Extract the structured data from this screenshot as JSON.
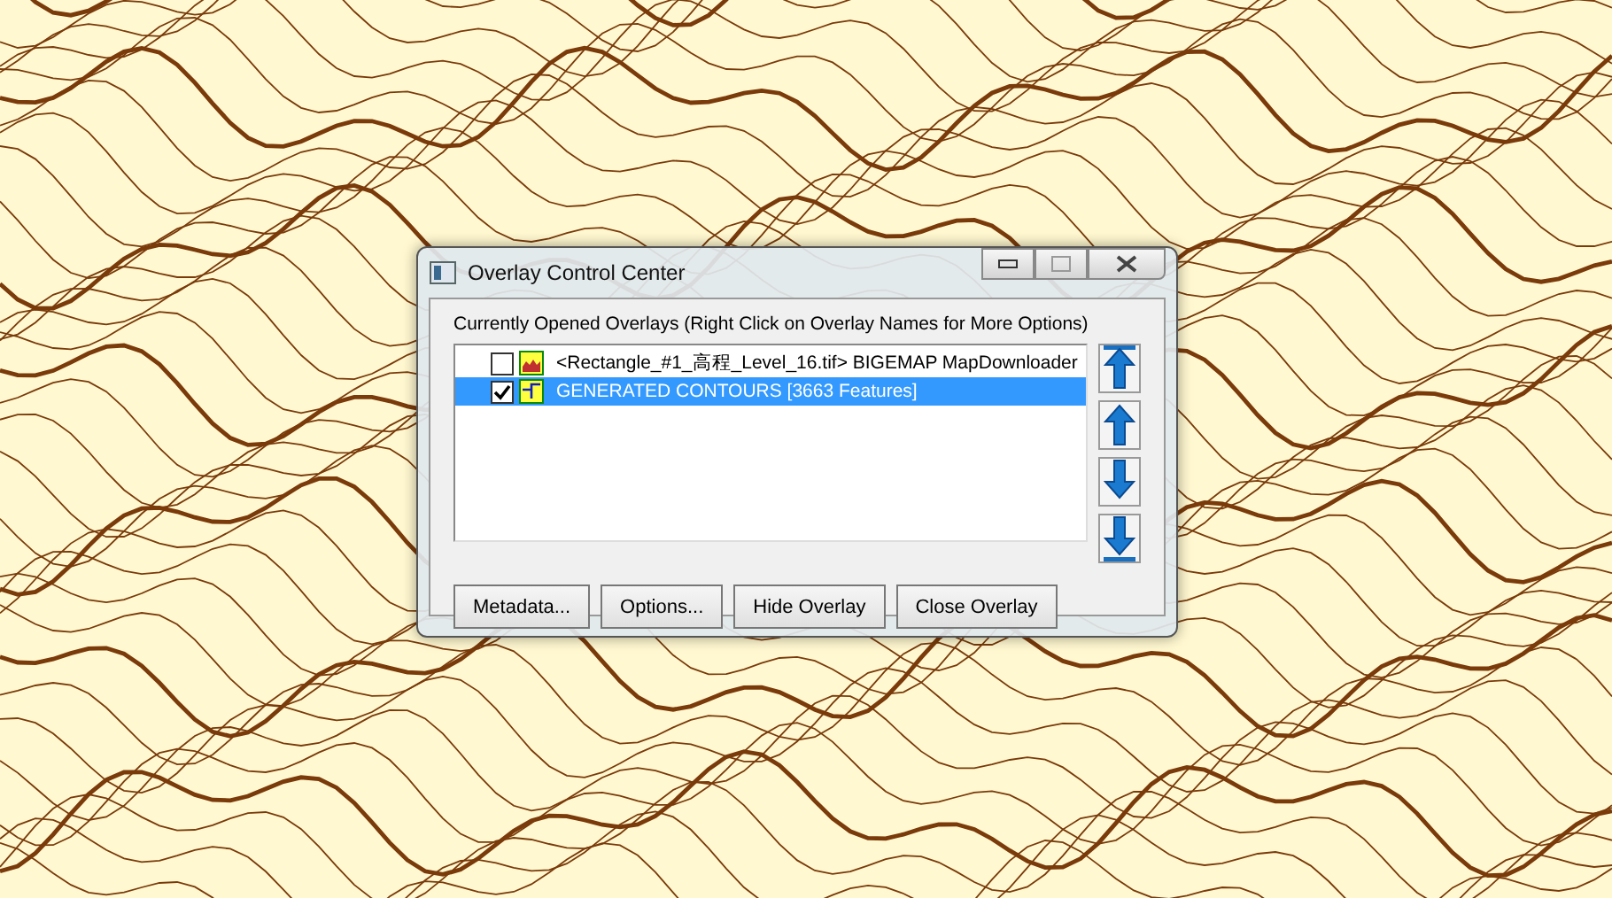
{
  "window": {
    "title": "Overlay Control Center"
  },
  "list_label": "Currently Opened Overlays (Right Click on Overlay Names for More Options)",
  "overlays": [
    {
      "name": "<Rectangle_#1_高程_Level_16.tif> BIGEMAP MapDownloader",
      "kind": "raster",
      "checked": false,
      "selected": false
    },
    {
      "name": "GENERATED CONTOURS [3663 Features]",
      "kind": "vector",
      "checked": true,
      "selected": true
    }
  ],
  "buttons": [
    "Metadata...",
    "Options...",
    "Hide Overlay",
    "Close Overlay"
  ]
}
